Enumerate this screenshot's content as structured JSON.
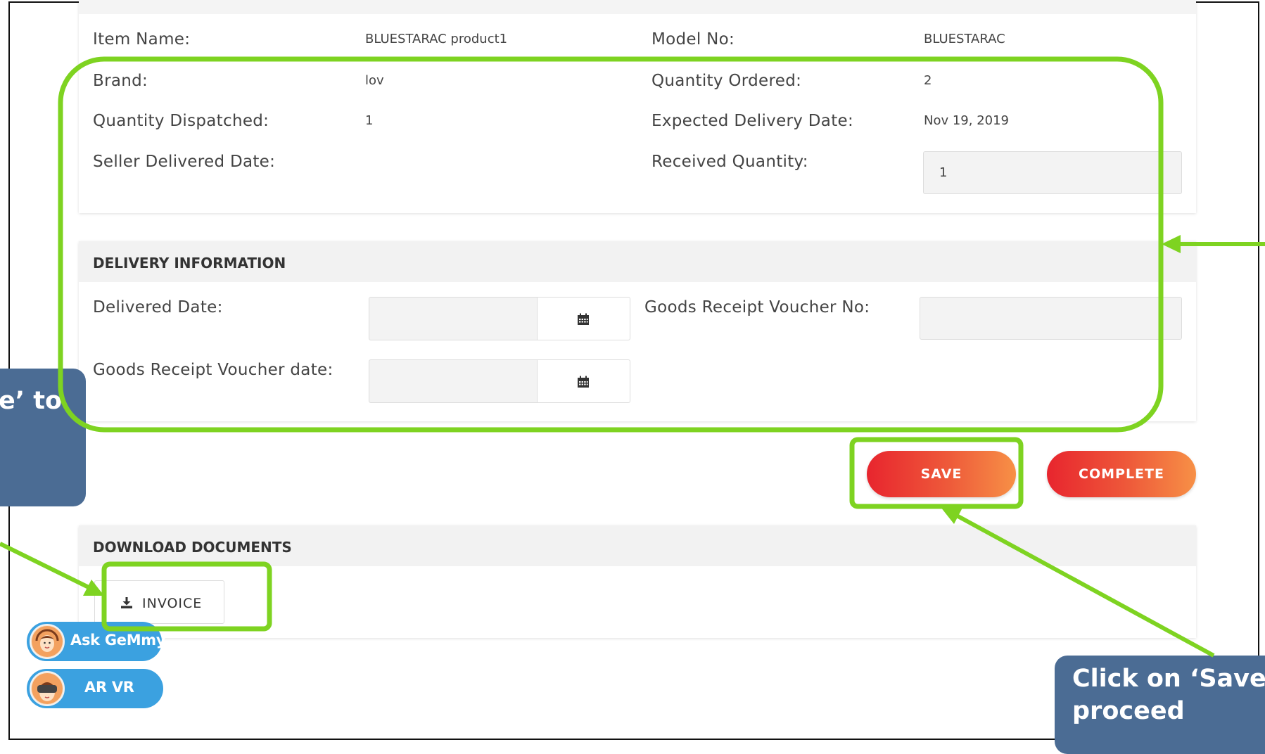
{
  "item_details": {
    "item_name_label": "Item Name:",
    "item_name_value": "BLUESTARAC product1",
    "model_no_label": "Model No:",
    "model_no_value": "BLUESTARAC",
    "brand_label": "Brand:",
    "brand_value": "lov",
    "quantity_ordered_label": "Quantity Ordered:",
    "quantity_ordered_value": "2",
    "quantity_dispatched_label": "Quantity Dispatched:",
    "quantity_dispatched_value": "1",
    "expected_delivery_label": "Expected Delivery Date:",
    "expected_delivery_value": "Nov 19, 2019",
    "seller_delivered_label": "Seller Delivered Date:",
    "received_quantity_label": "Received Quantity:",
    "received_quantity_value": "1"
  },
  "delivery": {
    "title": "DELIVERY INFORMATION",
    "delivered_date_label": "Delivered Date:",
    "voucher_no_label": "Goods Receipt Voucher No:",
    "voucher_date_label": "Goods Receipt Voucher date:"
  },
  "actions": {
    "save_label": "SAVE",
    "complete_label": "COMPLETE"
  },
  "documents": {
    "title": "DOWNLOAD DOCUMENTS",
    "invoice_label": "INVOICE"
  },
  "assist": {
    "ask_label": "Ask GeMmy",
    "arvr_label": "AR VR"
  },
  "callouts": {
    "left_text": "e’ to",
    "right_line1": "Click on ‘Save’ t",
    "right_line2": "proceed"
  },
  "colors": {
    "highlight": "#7ed321",
    "button_gradient_start": "#e8252e",
    "button_gradient_end": "#f79046",
    "callout_bg": "#4b6c94",
    "assist_pill": "#3ba1e0"
  }
}
